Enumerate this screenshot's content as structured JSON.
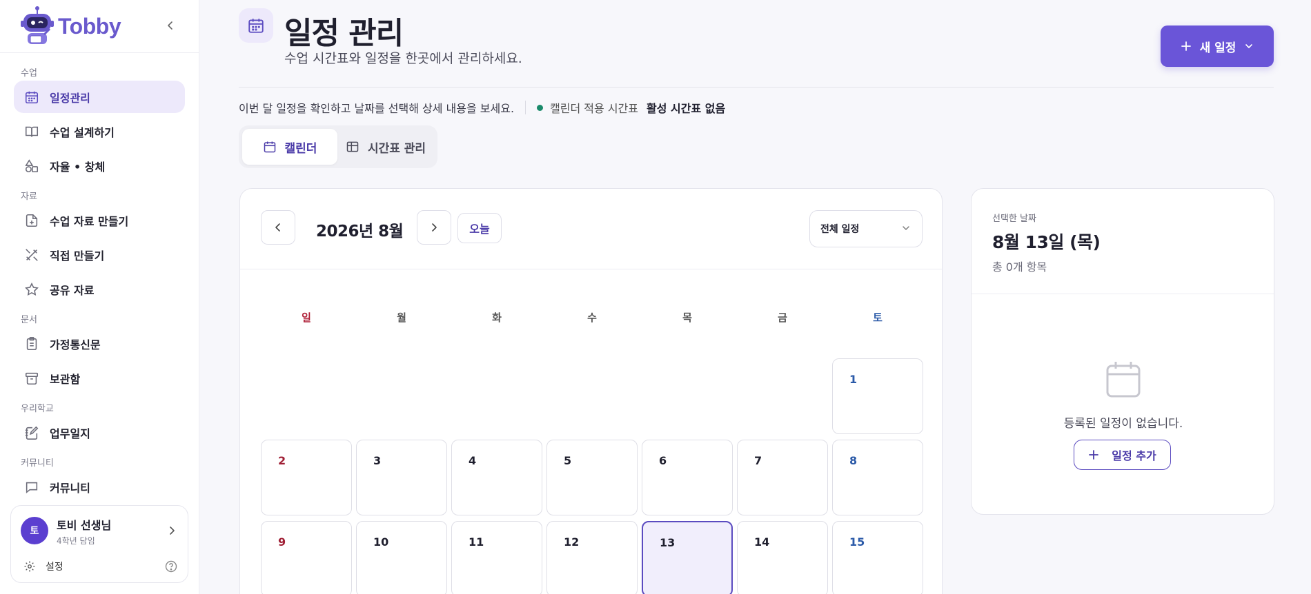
{
  "brand": {
    "name": "Tobby"
  },
  "sidebar": {
    "sections": [
      {
        "title": "수업",
        "items": [
          {
            "label": "일정관리",
            "icon": "calendar-icon",
            "active": true
          },
          {
            "label": "수업 설계하기",
            "icon": "book-icon"
          },
          {
            "label": "자율 • 창체",
            "icon": "shapes-icon"
          }
        ]
      },
      {
        "title": "자료",
        "items": [
          {
            "label": "수업 자료 만들기",
            "icon": "file-plus-icon"
          },
          {
            "label": "직접 만들기",
            "icon": "pencil-ruler-icon"
          },
          {
            "label": "공유 자료",
            "icon": "star-icon"
          }
        ]
      },
      {
        "title": "문서",
        "items": [
          {
            "label": "가정통신문",
            "icon": "clipboard-icon"
          },
          {
            "label": "보관함",
            "icon": "archive-icon"
          }
        ]
      },
      {
        "title": "우리학교",
        "items": [
          {
            "label": "업무일지",
            "icon": "notebook-pen-icon"
          }
        ]
      },
      {
        "title": "커뮤니티",
        "items": [
          {
            "label": "커뮤니티",
            "icon": "message-icon"
          }
        ]
      }
    ]
  },
  "user": {
    "avatar_text": "토",
    "name": "토비 선생님",
    "role": "4학년 담임",
    "settings_label": "설정"
  },
  "header": {
    "title": "일정 관리",
    "subtitle": "수업 시간표와 일정을 한곳에서 관리하세요.",
    "new_button": "새 일정"
  },
  "info": {
    "description": "이번 달 일정을 확인하고 날짜를 선택해 상세 내용을 보세요.",
    "timetable_label": "캘린더 적용 시간표",
    "timetable_value": "활성 시간표 없음",
    "status_color": "#1a8a6a"
  },
  "tabs": {
    "calendar": "캘린더",
    "timetable": "시간표 관리"
  },
  "calendar": {
    "month_label": "2026년 8월",
    "today_label": "오늘",
    "filter_label": "전체 일정",
    "weekdays": [
      "일",
      "월",
      "화",
      "수",
      "목",
      "금",
      "토"
    ],
    "leading_blank_days": 6,
    "visible_days": [
      1,
      2,
      3,
      4,
      5,
      6,
      7,
      8,
      9,
      10,
      11,
      12,
      13,
      14,
      15
    ],
    "selected_day": 13,
    "accent_color": "#5b4bc0"
  },
  "selected_panel": {
    "label": "선택한 날짜",
    "date": "8월 13일 (목)",
    "count": "총 0개 항목",
    "empty_text": "등록된 일정이 없습니다.",
    "add_button": "일정 추가"
  }
}
